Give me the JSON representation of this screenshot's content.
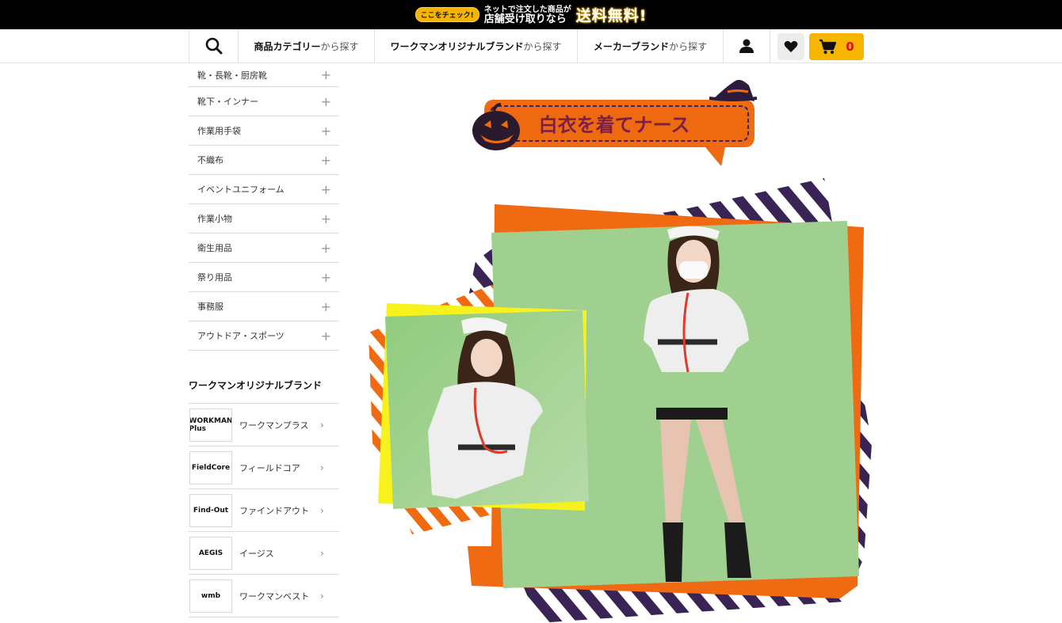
{
  "banner": {
    "pill": "ここをチェック!",
    "line1": "ネットで注文した商品が",
    "line2": "店舗受け取りなら",
    "big": "送料無料!"
  },
  "nav": {
    "category_strong": "商品カテゴリー",
    "category_weak": "から探す",
    "original_strong": "ワークマンオリジナルブランド",
    "original_weak": "から探す",
    "maker_strong": "メーカーブランド",
    "maker_weak": "から探す",
    "cart_count": "0"
  },
  "sidebar": {
    "categories": [
      {
        "label": "靴・長靴・厨房靴"
      },
      {
        "label": "靴下・インナー"
      },
      {
        "label": "作業用手袋"
      },
      {
        "label": "不織布"
      },
      {
        "label": "イベントユニフォーム"
      },
      {
        "label": "作業小物"
      },
      {
        "label": "衛生用品"
      },
      {
        "label": "祭り用品"
      },
      {
        "label": "事務服"
      },
      {
        "label": "アウトドア・スポーツ"
      }
    ],
    "brand_heading": "ワークマンオリジナルブランド",
    "brands": [
      {
        "label": "ワークマンプラス",
        "logo": "WORKMAN Plus"
      },
      {
        "label": "フィールドコア",
        "logo": "FieldCore"
      },
      {
        "label": "ファインドアウト",
        "logo": "Find-Out"
      },
      {
        "label": "イージス",
        "logo": "AEGIS"
      },
      {
        "label": "ワークマンベスト",
        "logo": "wmb"
      }
    ]
  },
  "hero": {
    "title": "白衣を着てナース"
  },
  "colors": {
    "accent_yellow": "#f7b500",
    "halloween_orange": "#f06a12",
    "halloween_purple": "#3a2455",
    "photo_green": "#9fd08f",
    "cart_red": "#d11111"
  }
}
